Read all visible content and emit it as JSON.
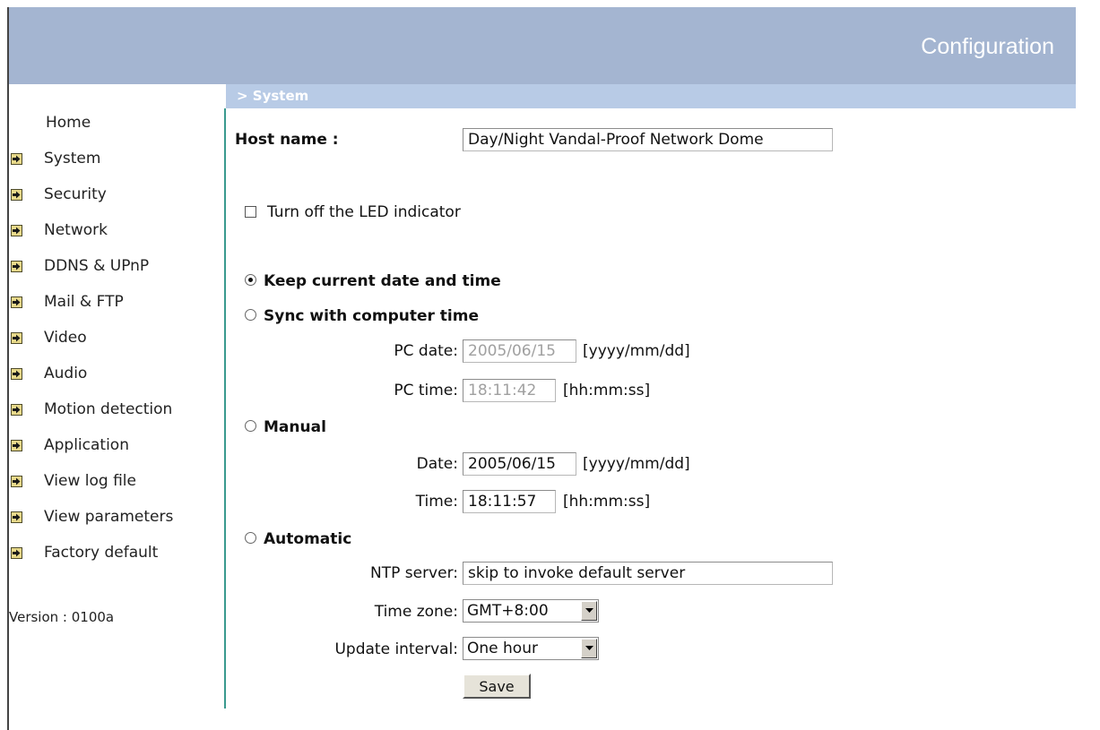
{
  "header": {
    "title": "Configuration"
  },
  "section": {
    "title": "> System"
  },
  "sidebar": {
    "home_label": "Home",
    "items": [
      {
        "label": "System"
      },
      {
        "label": "Security"
      },
      {
        "label": "Network"
      },
      {
        "label": "DDNS & UPnP"
      },
      {
        "label": "Mail & FTP"
      },
      {
        "label": "Video"
      },
      {
        "label": "Audio"
      },
      {
        "label": "Motion detection"
      },
      {
        "label": "Application"
      },
      {
        "label": "View log file"
      },
      {
        "label": "View parameters"
      },
      {
        "label": "Factory default"
      }
    ],
    "version": "Version : 0100a"
  },
  "form": {
    "host_name_label": "Host name :",
    "host_name_value": "Day/Night Vandal-Proof Network Dome",
    "led_label": "Turn off the LED indicator",
    "led_checked": false,
    "keep_label": "Keep current date and time",
    "sync_label": "Sync with computer time",
    "pc_date_label": "PC date:",
    "pc_date_value": "2005/06/15",
    "pc_date_format": "[yyyy/mm/dd]",
    "pc_time_label": "PC time:",
    "pc_time_value": "18:11:42",
    "pc_time_format": "[hh:mm:ss]",
    "manual_label": "Manual",
    "date_label": "Date:",
    "date_value": "2005/06/15",
    "date_format": "[yyyy/mm/dd]",
    "time_label": "Time:",
    "time_value": "18:11:57",
    "time_format": "[hh:mm:ss]",
    "automatic_label": "Automatic",
    "ntp_label": "NTP server:",
    "ntp_value": "skip to invoke default server",
    "timezone_label": "Time zone:",
    "timezone_value": "GMT+8:00",
    "interval_label": "Update interval:",
    "interval_value": "One hour",
    "save_label": "Save",
    "selected_mode": "keep"
  },
  "colors": {
    "banner": "#a4b5d1",
    "section_bar": "#b8cbe6",
    "divider": "#3a9a8f"
  },
  "icons": {
    "nav_item": "arrow-right-icon",
    "dropdown": "chevron-down-icon"
  }
}
